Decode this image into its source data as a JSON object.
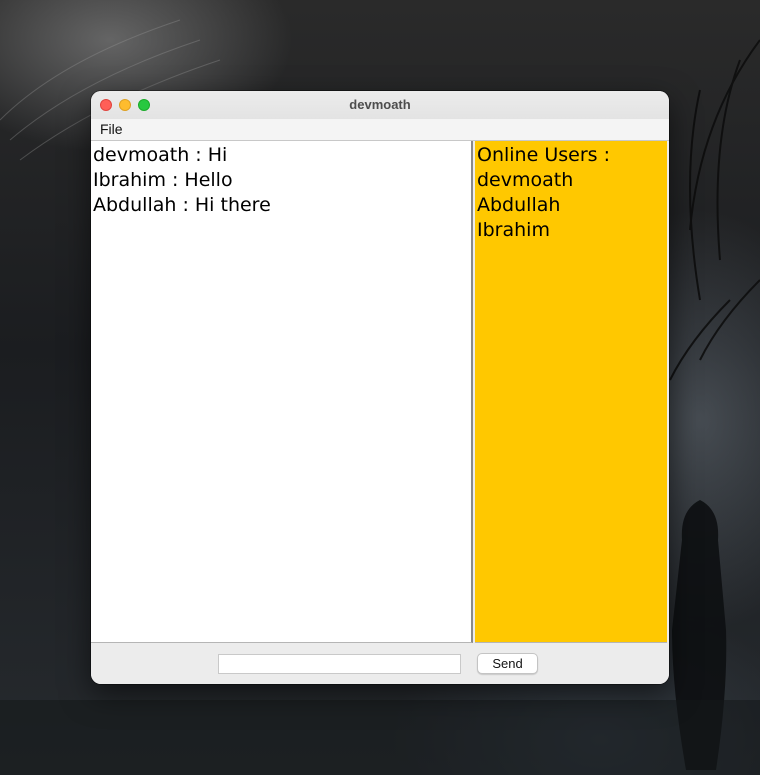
{
  "window": {
    "title": "devmoath"
  },
  "menubar": {
    "items": [
      {
        "label": "File"
      }
    ]
  },
  "chat": {
    "messages": [
      {
        "text": "devmoath : Hi"
      },
      {
        "text": "Ibrahim : Hello"
      },
      {
        "text": "Abdullah : Hi there"
      }
    ]
  },
  "users": {
    "header": "Online Users :",
    "list": [
      {
        "name": "devmoath"
      },
      {
        "name": "Abdullah"
      },
      {
        "name": "Ibrahim"
      }
    ]
  },
  "composer": {
    "input_value": "",
    "send_label": "Send"
  },
  "colors": {
    "users_panel_bg": "#ffc800",
    "chat_bg": "#ffffff",
    "window_bg": "#ececec",
    "close": "#ff5f57",
    "minimize": "#febc2e",
    "zoom": "#28c840"
  },
  "icons": {
    "close": "close-icon",
    "minimize": "minimize-icon",
    "zoom": "zoom-icon"
  }
}
